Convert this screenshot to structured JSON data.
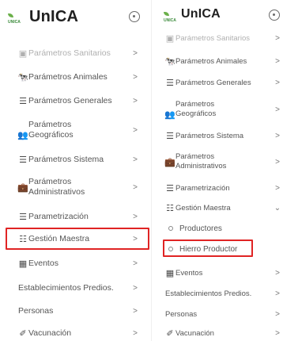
{
  "brand": {
    "mini": "UNICA",
    "name": "UnICA"
  },
  "left_menu": [
    {
      "label": "Parámetros Sanitarios",
      "icon": "sanitary-icon",
      "chevron": ">"
    },
    {
      "label": "Parámetros Animales",
      "icon": "animal-icon",
      "chevron": ">"
    },
    {
      "label": "Parámetros Generales",
      "icon": "sliders-icon",
      "chevron": ">"
    },
    {
      "label": "Parámetros Geográficos",
      "line1": "Parámetros",
      "line2": "Geográficos",
      "icon": "people-icon",
      "chevron": ">"
    },
    {
      "label": "Parámetros Sistema",
      "icon": "sliders-icon",
      "chevron": ">"
    },
    {
      "label": "Parámetros Administrativos",
      "line1": "Parámetros",
      "line2": "Administrativos",
      "icon": "briefcase-icon",
      "chevron": ">"
    },
    {
      "label": "Parametrización",
      "icon": "sliders-icon",
      "chevron": ">"
    },
    {
      "label": "Gestión Maestra",
      "icon": "list-icon",
      "chevron": ">"
    },
    {
      "label": "Eventos",
      "icon": "calendar-icon",
      "chevron": ">"
    },
    {
      "label": "Establecimientos Predios.",
      "icon": "",
      "chevron": ">"
    },
    {
      "label": "Personas",
      "icon": "",
      "chevron": ">"
    },
    {
      "label": "Vacunación",
      "icon": "syringe-icon",
      "chevron": ">"
    }
  ],
  "right_menu": [
    {
      "label": "Parámetros Sanitarios",
      "icon": "sanitary-icon",
      "chevron": ">"
    },
    {
      "label": "Parámetros Animales",
      "icon": "animal-icon",
      "chevron": ">"
    },
    {
      "label": "Parámetros Generales",
      "icon": "sliders-icon",
      "chevron": ">"
    },
    {
      "label": "Parámetros Geográficos",
      "line1": "Parámetros",
      "line2": "Geográficos",
      "icon": "people-icon",
      "chevron": ">"
    },
    {
      "label": "Parámetros Sistema",
      "icon": "sliders-icon",
      "chevron": ">"
    },
    {
      "label": "Parámetros Administrativos",
      "line1": "Parámetros",
      "line2": "Administrativos",
      "icon": "briefcase-icon",
      "chevron": ">"
    },
    {
      "label": "Parametrización",
      "icon": "sliders-icon",
      "chevron": ">"
    },
    {
      "label": "Gestión Maestra",
      "icon": "list-icon",
      "chevron": "⌄"
    },
    {
      "label": "Eventos",
      "icon": "calendar-icon",
      "chevron": ">"
    },
    {
      "label": "Establecimientos Predios.",
      "icon": "",
      "chevron": ">"
    },
    {
      "label": "Personas",
      "icon": "",
      "chevron": ">"
    },
    {
      "label": "Vacunación",
      "icon": "syringe-icon",
      "chevron": ">"
    }
  ],
  "submenu": [
    {
      "label": "Productores"
    },
    {
      "label": "Hierro Productor"
    }
  ],
  "colors": {
    "highlight": "#e02424",
    "logo_green": "#6bb04a"
  }
}
